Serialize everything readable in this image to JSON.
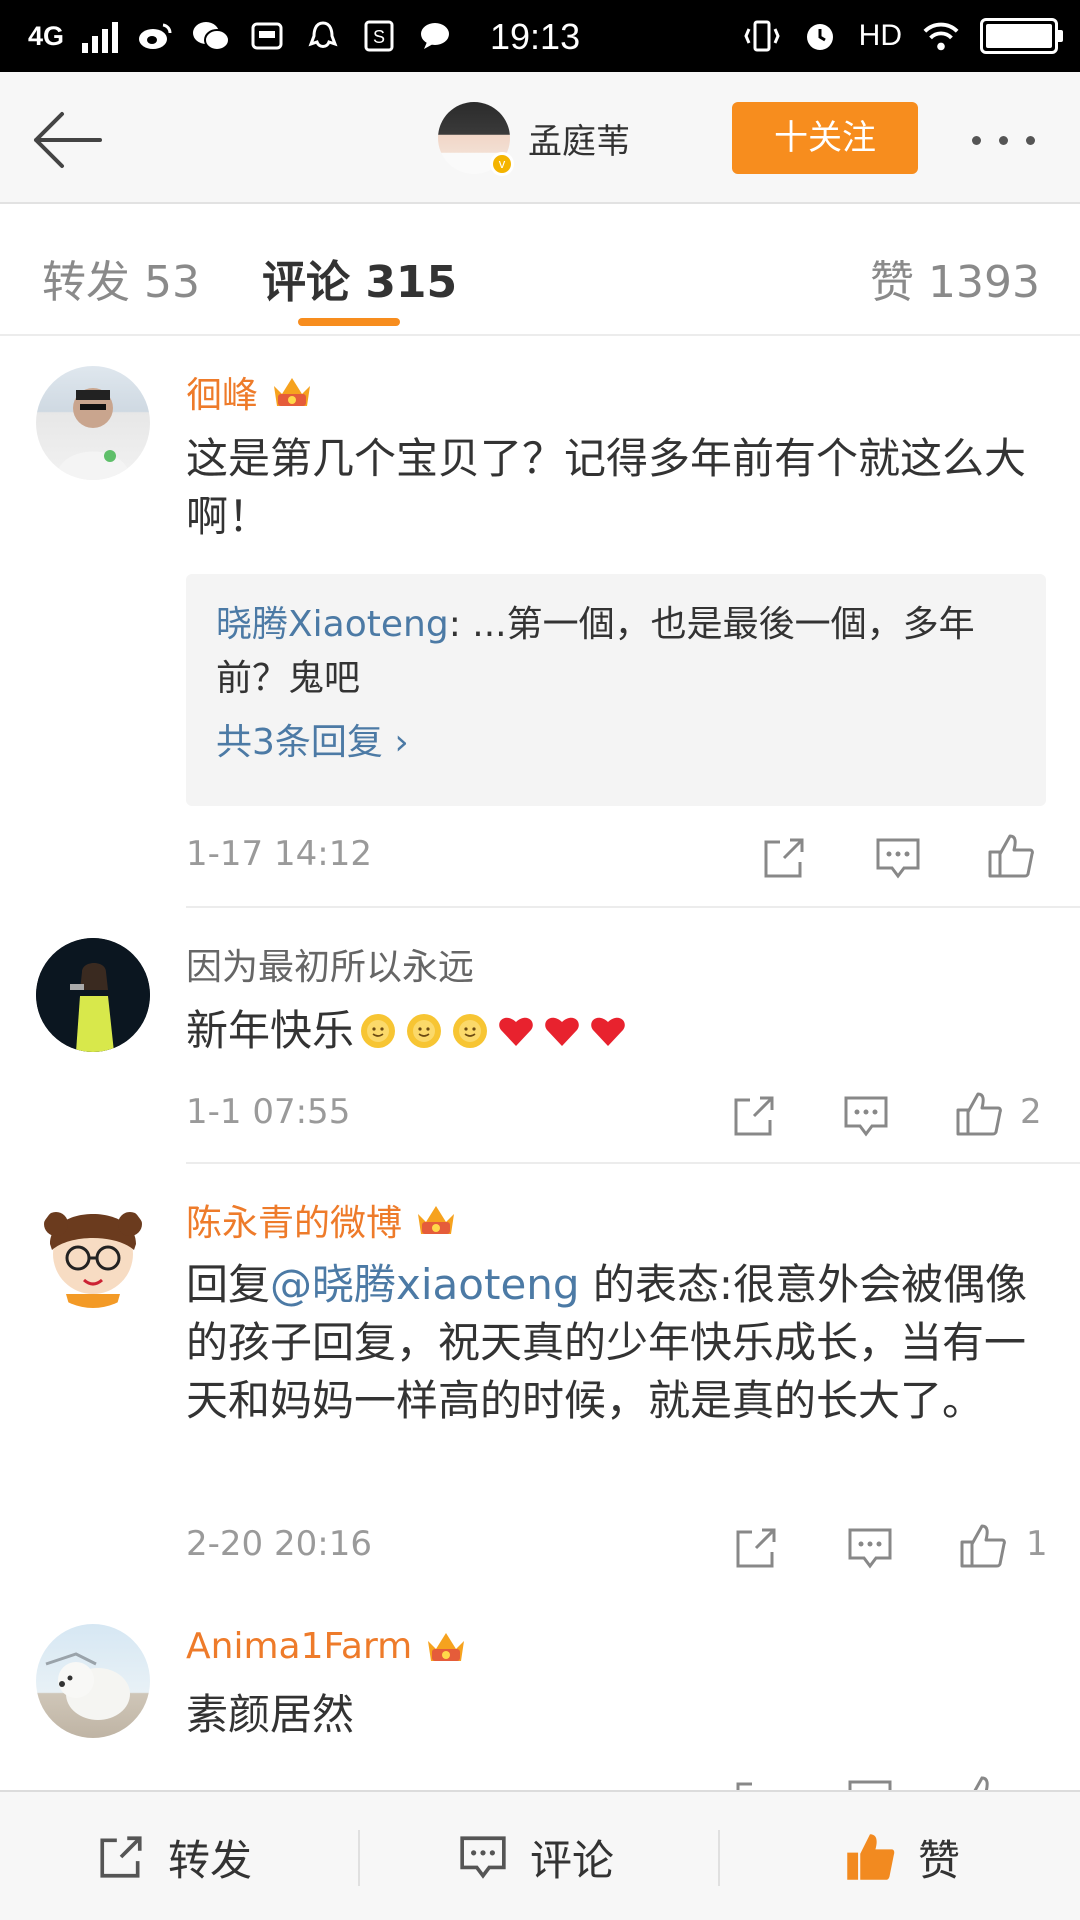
{
  "status_bar": {
    "network": "4G",
    "time": "19:13",
    "hd": "HD"
  },
  "header": {
    "back_icon": "back-arrow-icon",
    "nickname": "孟庭苇",
    "follow_label": "十关注",
    "more_icon": "more-dots-icon"
  },
  "tabs": {
    "forward": "转发 53",
    "comments": "评论 315",
    "likes": "赞 1393"
  },
  "comments": [
    {
      "name": "徊峰",
      "name_color": "#ee7b2a",
      "text": "这是第几个宝贝了？记得多年前有个就这么大啊！",
      "reply_user": "晓腾Xiaoteng",
      "reply_text": ": ...第一個，也是最後一個，多年前？鬼吧",
      "reply_more": "共3条回复 ›",
      "time": "1-17 14:12",
      "likes": ""
    },
    {
      "name": "因为最初所以永远",
      "name_color": "#666666",
      "text": "新年快乐",
      "time": "1-1 07:55",
      "likes": "2"
    },
    {
      "name": "陈永青的微博",
      "name_color": "#ee7b2a",
      "text_prefix": "回复",
      "mention": "@晓腾xiaoteng",
      "text_suffix": " 的表态:很意外会被偶像的孩子回复，祝天真的少年快乐成长，当有一天和妈妈一样高的时候，就是真的长大了。",
      "time": "2-20 20:16",
      "likes": "1"
    },
    {
      "name": "Anima1Farm",
      "name_color": "#ee7b2a",
      "text": "素颜居然",
      "time": "",
      "likes": ""
    }
  ],
  "bottom_bar": {
    "forward": "转发",
    "comment": "评论",
    "like": "赞"
  },
  "colors": {
    "accent": "#f78d1e",
    "link": "#4c7aa5",
    "vip_name": "#ee7b2a"
  }
}
